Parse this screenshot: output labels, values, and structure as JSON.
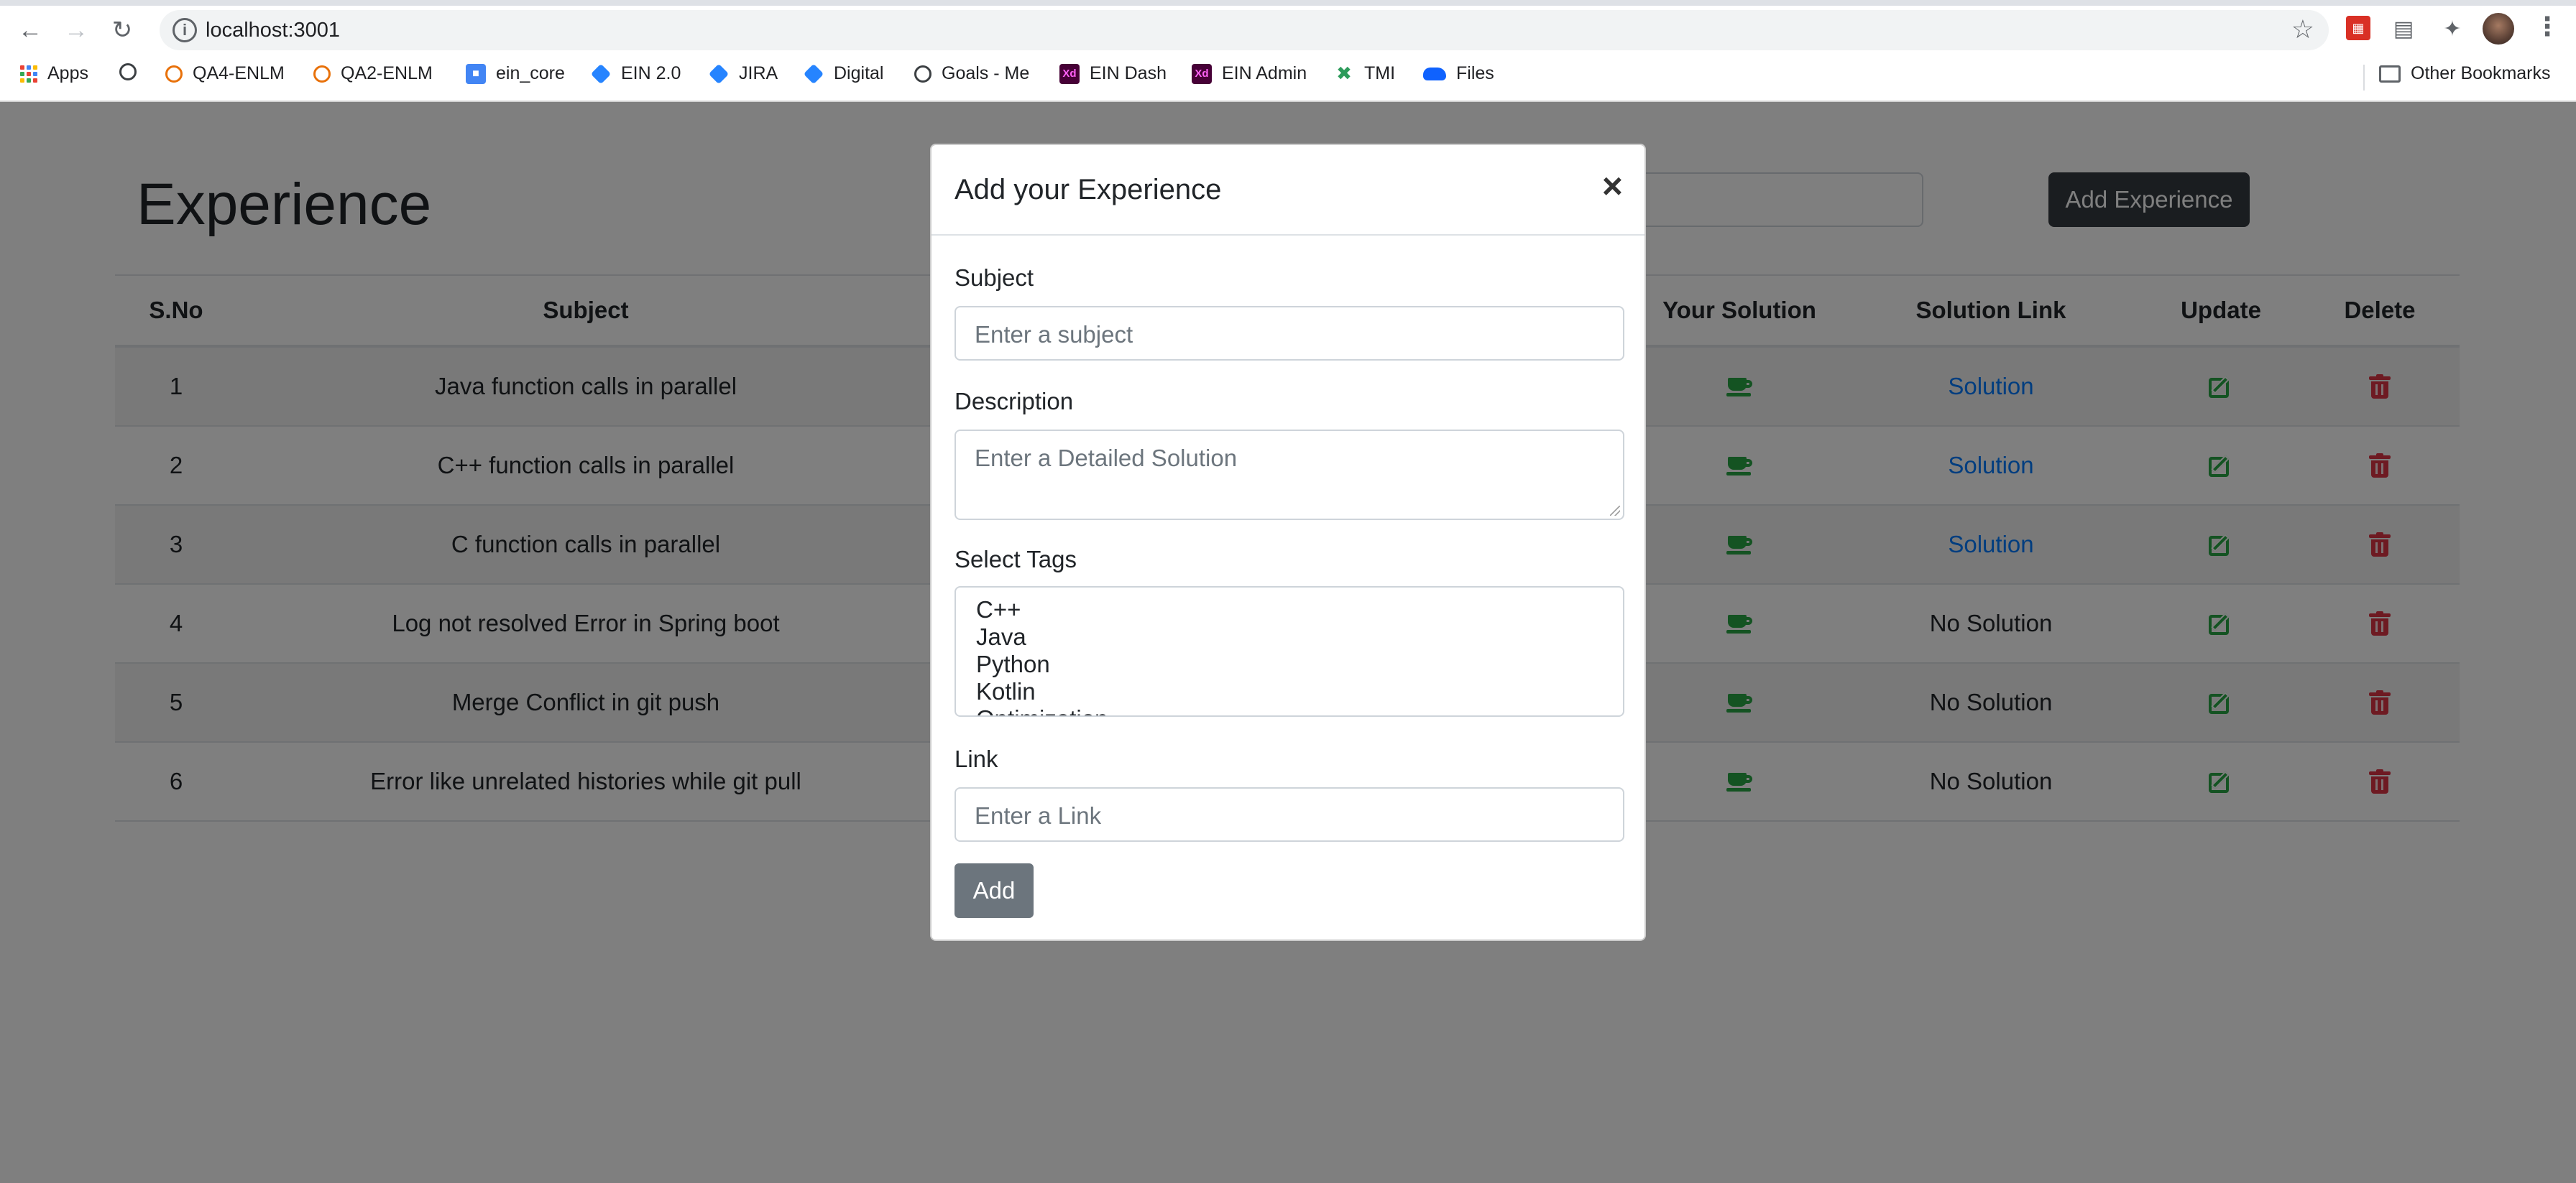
{
  "browser": {
    "url": "localhost:3001",
    "bookmarks": [
      {
        "label": "Apps",
        "icon": "apps-grid-icon"
      },
      {
        "label": "",
        "icon": "globe-icon"
      },
      {
        "label": "QA4-ENLM",
        "icon": "ring-icon"
      },
      {
        "label": "QA2-ENLM",
        "icon": "ring-icon"
      },
      {
        "label": "ein_core",
        "icon": "shield-icon"
      },
      {
        "label": "EIN 2.0",
        "icon": "jira-icon"
      },
      {
        "label": "JIRA",
        "icon": "jira-icon"
      },
      {
        "label": "Digital",
        "icon": "jira-icon"
      },
      {
        "label": "Goals - Me",
        "icon": "globe-icon"
      },
      {
        "label": "EIN Dash",
        "icon": "xd-icon"
      },
      {
        "label": "EIN Admin",
        "icon": "xd-icon"
      },
      {
        "label": "TMI",
        "icon": "x-icon"
      },
      {
        "label": "Files",
        "icon": "cloud-icon"
      }
    ],
    "other_bookmarks": "Other Bookmarks",
    "xd_glyph": "Xd"
  },
  "page": {
    "title": "Experience",
    "add_button": "Add Experience",
    "table": {
      "headers": {
        "sno": "S.No",
        "subject": "Subject",
        "your_solution": "Your Solution",
        "solution_link": "Solution Link",
        "update": "Update",
        "delete": "Delete"
      },
      "rows": [
        {
          "sno": "1",
          "subject": "Java function calls in parallel",
          "link": "Solution"
        },
        {
          "sno": "2",
          "subject": "C++ function calls in parallel",
          "link": "Solution"
        },
        {
          "sno": "3",
          "subject": "C function calls in parallel",
          "link": "Solution"
        },
        {
          "sno": "4",
          "subject": "Log not resolved Error in Spring boot",
          "link": "No Solution"
        },
        {
          "sno": "5",
          "subject": "Merge Conflict in git push",
          "link": "No Solution"
        },
        {
          "sno": "6",
          "subject": "Error like unrelated histories while git pull",
          "link": "No Solution"
        }
      ]
    }
  },
  "modal": {
    "title": "Add your Experience",
    "close": "×",
    "subject_label": "Subject",
    "subject_placeholder": "Enter a subject",
    "description_label": "Description",
    "description_placeholder": "Enter a Detailed Solution",
    "tags_label": "Select Tags",
    "tags": [
      "C++",
      "Java",
      "Python",
      "Kotlin",
      "Optimization"
    ],
    "link_label": "Link",
    "link_placeholder": "Enter a Link",
    "submit": "Add"
  },
  "colors": {
    "dark_button": "#343a40",
    "secondary_button": "#6c757d",
    "success": "#28a745",
    "danger": "#dc3545",
    "link": "#007bff",
    "backdrop": "rgba(0,0,0,0.5)"
  }
}
